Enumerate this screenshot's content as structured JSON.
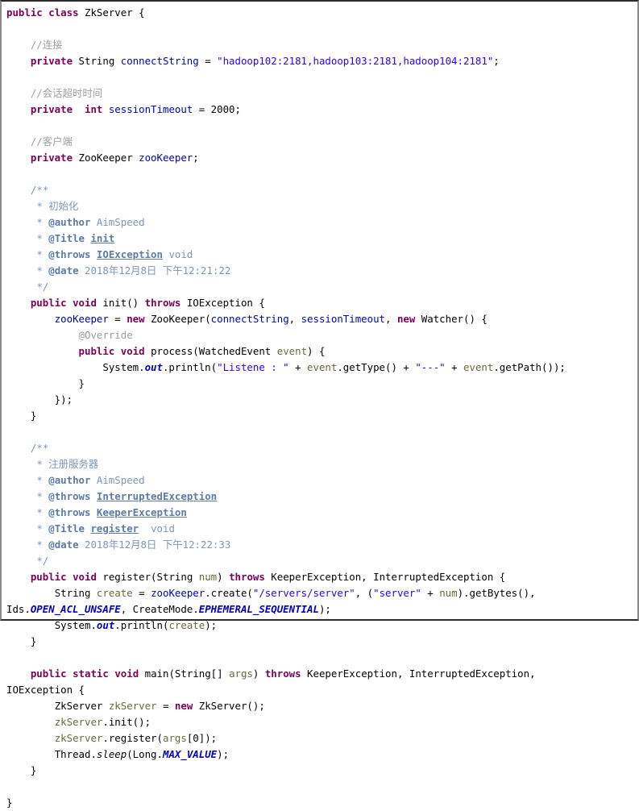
{
  "document": {
    "kind": "java-source-listing",
    "class_name": "ZkServer",
    "background_color": "#ffffff",
    "colors": {
      "keyword": "#7f0055",
      "string": "#2a00ff",
      "comment": "#a0a0a0",
      "javadoc": "#7e96b8",
      "javadoc_tag": "#5c7ba8",
      "field": "#0000c0",
      "local_variable": "#6a6a3c",
      "static_constant": "#0000c0",
      "plain_text": "#000000",
      "border": "#2b2b2b"
    }
  },
  "code": {
    "lines": [
      {
        "id": "l1",
        "tokens": [
          {
            "t": "public",
            "c": "kw"
          },
          {
            "t": " ",
            "c": "plain"
          },
          {
            "t": "class",
            "c": "kw"
          },
          {
            "t": " ZkServer {",
            "c": "plain"
          }
        ]
      },
      {
        "id": "l2",
        "tokens": []
      },
      {
        "id": "l3",
        "tokens": [
          {
            "t": "    ",
            "c": "plain"
          },
          {
            "t": "//连接",
            "c": "cmt"
          }
        ]
      },
      {
        "id": "l4",
        "tokens": [
          {
            "t": "    ",
            "c": "plain"
          },
          {
            "t": "private",
            "c": "kw"
          },
          {
            "t": " String ",
            "c": "plain"
          },
          {
            "t": "connectString",
            "c": "field"
          },
          {
            "t": " = ",
            "c": "plain"
          },
          {
            "t": "\"hadoop102:2181,hadoop103:2181,hadoop104:2181\"",
            "c": "str"
          },
          {
            "t": ";",
            "c": "plain"
          }
        ]
      },
      {
        "id": "l5",
        "tokens": []
      },
      {
        "id": "l6",
        "tokens": [
          {
            "t": "    ",
            "c": "plain"
          },
          {
            "t": "//会话超时时间",
            "c": "cmt"
          }
        ]
      },
      {
        "id": "l7",
        "tokens": [
          {
            "t": "    ",
            "c": "plain"
          },
          {
            "t": "private",
            "c": "kw"
          },
          {
            "t": "  ",
            "c": "plain"
          },
          {
            "t": "int",
            "c": "kw"
          },
          {
            "t": " ",
            "c": "plain"
          },
          {
            "t": "sessionTimeout",
            "c": "field"
          },
          {
            "t": " = 2000;",
            "c": "plain"
          }
        ]
      },
      {
        "id": "l8",
        "tokens": []
      },
      {
        "id": "l9",
        "tokens": [
          {
            "t": "    ",
            "c": "plain"
          },
          {
            "t": "//客户端",
            "c": "cmt"
          }
        ]
      },
      {
        "id": "l10",
        "tokens": [
          {
            "t": "    ",
            "c": "plain"
          },
          {
            "t": "private",
            "c": "kw"
          },
          {
            "t": " ZooKeeper ",
            "c": "plain"
          },
          {
            "t": "zooKeeper",
            "c": "field"
          },
          {
            "t": ";",
            "c": "plain"
          }
        ]
      },
      {
        "id": "l11",
        "tokens": []
      },
      {
        "id": "l12",
        "tokens": [
          {
            "t": "    ",
            "c": "plain"
          },
          {
            "t": "/**",
            "c": "doc"
          }
        ]
      },
      {
        "id": "l13",
        "tokens": [
          {
            "t": "     ",
            "c": "plain"
          },
          {
            "t": "* 初始化",
            "c": "doc"
          }
        ]
      },
      {
        "id": "l14",
        "tokens": [
          {
            "t": "     ",
            "c": "plain"
          },
          {
            "t": "* ",
            "c": "doc"
          },
          {
            "t": "@author",
            "c": "doctag"
          },
          {
            "t": " AimSpeed",
            "c": "doc"
          }
        ]
      },
      {
        "id": "l15",
        "tokens": [
          {
            "t": "     ",
            "c": "plain"
          },
          {
            "t": "* ",
            "c": "doc"
          },
          {
            "t": "@Title",
            "c": "doctag"
          },
          {
            "t": " ",
            "c": "doc"
          },
          {
            "t": "init",
            "c": "docu"
          }
        ]
      },
      {
        "id": "l16",
        "tokens": [
          {
            "t": "     ",
            "c": "plain"
          },
          {
            "t": "* ",
            "c": "doc"
          },
          {
            "t": "@throws",
            "c": "doctag"
          },
          {
            "t": " ",
            "c": "doc"
          },
          {
            "t": "IOException",
            "c": "docu"
          },
          {
            "t": " void",
            "c": "doc"
          }
        ]
      },
      {
        "id": "l17",
        "tokens": [
          {
            "t": "     ",
            "c": "plain"
          },
          {
            "t": "* ",
            "c": "doc"
          },
          {
            "t": "@date",
            "c": "doctag"
          },
          {
            "t": " 2018年12月8日 下午12:21:22",
            "c": "doc"
          }
        ]
      },
      {
        "id": "l18",
        "tokens": [
          {
            "t": "     ",
            "c": "plain"
          },
          {
            "t": "*/",
            "c": "doc"
          }
        ]
      },
      {
        "id": "l19",
        "tokens": [
          {
            "t": "    ",
            "c": "plain"
          },
          {
            "t": "public",
            "c": "kw"
          },
          {
            "t": " ",
            "c": "plain"
          },
          {
            "t": "void",
            "c": "kw"
          },
          {
            "t": " init() ",
            "c": "plain"
          },
          {
            "t": "throws",
            "c": "kw"
          },
          {
            "t": " IOException {",
            "c": "plain"
          }
        ]
      },
      {
        "id": "l20",
        "tokens": [
          {
            "t": "        ",
            "c": "plain"
          },
          {
            "t": "zooKeeper",
            "c": "field"
          },
          {
            "t": " = ",
            "c": "plain"
          },
          {
            "t": "new",
            "c": "kw"
          },
          {
            "t": " ZooKeeper(",
            "c": "plain"
          },
          {
            "t": "connectString",
            "c": "field"
          },
          {
            "t": ", ",
            "c": "plain"
          },
          {
            "t": "sessionTimeout",
            "c": "field"
          },
          {
            "t": ", ",
            "c": "plain"
          },
          {
            "t": "new",
            "c": "kw"
          },
          {
            "t": " Watcher() {",
            "c": "plain"
          }
        ]
      },
      {
        "id": "l21",
        "tokens": [
          {
            "t": "            ",
            "c": "plain"
          },
          {
            "t": "@Override",
            "c": "anno"
          }
        ]
      },
      {
        "id": "l22",
        "tokens": [
          {
            "t": "            ",
            "c": "plain"
          },
          {
            "t": "public",
            "c": "kw"
          },
          {
            "t": " ",
            "c": "plain"
          },
          {
            "t": "void",
            "c": "kw"
          },
          {
            "t": " process(WatchedEvent ",
            "c": "plain"
          },
          {
            "t": "event",
            "c": "local"
          },
          {
            "t": ") {",
            "c": "plain"
          }
        ]
      },
      {
        "id": "l23",
        "tokens": [
          {
            "t": "                ",
            "c": "plain"
          },
          {
            "t": "System.",
            "c": "plain"
          },
          {
            "t": "out",
            "c": "staticf"
          },
          {
            "t": ".println(",
            "c": "plain"
          },
          {
            "t": "\"Listene : \"",
            "c": "str"
          },
          {
            "t": " + ",
            "c": "plain"
          },
          {
            "t": "event",
            "c": "local"
          },
          {
            "t": ".getType() + ",
            "c": "plain"
          },
          {
            "t": "\"---\"",
            "c": "str"
          },
          {
            "t": " + ",
            "c": "plain"
          },
          {
            "t": "event",
            "c": "local"
          },
          {
            "t": ".getPath());",
            "c": "plain"
          }
        ]
      },
      {
        "id": "l24",
        "tokens": [
          {
            "t": "            }",
            "c": "plain"
          }
        ]
      },
      {
        "id": "l25",
        "tokens": [
          {
            "t": "        });",
            "c": "plain"
          }
        ]
      },
      {
        "id": "l26",
        "tokens": [
          {
            "t": "    }",
            "c": "plain"
          }
        ]
      },
      {
        "id": "l27",
        "tokens": []
      },
      {
        "id": "l28",
        "tokens": [
          {
            "t": "    ",
            "c": "plain"
          },
          {
            "t": "/**",
            "c": "doc"
          }
        ]
      },
      {
        "id": "l29",
        "tokens": [
          {
            "t": "     ",
            "c": "plain"
          },
          {
            "t": "* 注册服务器",
            "c": "doc"
          }
        ]
      },
      {
        "id": "l30",
        "tokens": [
          {
            "t": "     ",
            "c": "plain"
          },
          {
            "t": "* ",
            "c": "doc"
          },
          {
            "t": "@author",
            "c": "doctag"
          },
          {
            "t": " AimSpeed",
            "c": "doc"
          }
        ]
      },
      {
        "id": "l31",
        "tokens": [
          {
            "t": "     ",
            "c": "plain"
          },
          {
            "t": "* ",
            "c": "doc"
          },
          {
            "t": "@throws",
            "c": "doctag"
          },
          {
            "t": " ",
            "c": "doc"
          },
          {
            "t": "InterruptedException",
            "c": "docu"
          }
        ]
      },
      {
        "id": "l32",
        "tokens": [
          {
            "t": "     ",
            "c": "plain"
          },
          {
            "t": "* ",
            "c": "doc"
          },
          {
            "t": "@throws",
            "c": "doctag"
          },
          {
            "t": " ",
            "c": "doc"
          },
          {
            "t": "KeeperException",
            "c": "docu"
          }
        ]
      },
      {
        "id": "l33",
        "tokens": [
          {
            "t": "     ",
            "c": "plain"
          },
          {
            "t": "* ",
            "c": "doc"
          },
          {
            "t": "@Title",
            "c": "doctag"
          },
          {
            "t": " ",
            "c": "doc"
          },
          {
            "t": "register",
            "c": "docu"
          },
          {
            "t": "  void",
            "c": "doc"
          }
        ]
      },
      {
        "id": "l34",
        "tokens": [
          {
            "t": "     ",
            "c": "plain"
          },
          {
            "t": "* ",
            "c": "doc"
          },
          {
            "t": "@date",
            "c": "doctag"
          },
          {
            "t": " 2018年12月8日 下午12:22:33",
            "c": "doc"
          }
        ]
      },
      {
        "id": "l35",
        "tokens": [
          {
            "t": "     ",
            "c": "plain"
          },
          {
            "t": "*/",
            "c": "doc"
          }
        ]
      },
      {
        "id": "l36",
        "tokens": [
          {
            "t": "    ",
            "c": "plain"
          },
          {
            "t": "public",
            "c": "kw"
          },
          {
            "t": " ",
            "c": "plain"
          },
          {
            "t": "void",
            "c": "kw"
          },
          {
            "t": " register(String ",
            "c": "plain"
          },
          {
            "t": "num",
            "c": "local"
          },
          {
            "t": ") ",
            "c": "plain"
          },
          {
            "t": "throws",
            "c": "kw"
          },
          {
            "t": " KeeperException, InterruptedException {",
            "c": "plain"
          }
        ]
      },
      {
        "id": "l37",
        "tokens": [
          {
            "t": "        ",
            "c": "plain"
          },
          {
            "t": "String ",
            "c": "plain"
          },
          {
            "t": "create",
            "c": "local"
          },
          {
            "t": " = ",
            "c": "plain"
          },
          {
            "t": "zooKeeper",
            "c": "field"
          },
          {
            "t": ".create(",
            "c": "plain"
          },
          {
            "t": "\"/servers/server\"",
            "c": "str"
          },
          {
            "t": ", (",
            "c": "plain"
          },
          {
            "t": "\"server\"",
            "c": "str"
          },
          {
            "t": " + ",
            "c": "plain"
          },
          {
            "t": "num",
            "c": "local"
          },
          {
            "t": ").getBytes(),",
            "c": "plain"
          }
        ]
      },
      {
        "id": "l38",
        "tokens": [
          {
            "t": "Ids.",
            "c": "plain"
          },
          {
            "t": "OPEN_ACL_UNSAFE",
            "c": "statc"
          },
          {
            "t": ", CreateMode.",
            "c": "plain"
          },
          {
            "t": "EPHEMERAL_SEQUENTIAL",
            "c": "statc"
          },
          {
            "t": ");",
            "c": "plain"
          }
        ]
      },
      {
        "id": "l39",
        "tokens": [
          {
            "t": "        ",
            "c": "plain"
          },
          {
            "t": "System.",
            "c": "plain"
          },
          {
            "t": "out",
            "c": "staticf"
          },
          {
            "t": ".println(",
            "c": "plain"
          },
          {
            "t": "create",
            "c": "local"
          },
          {
            "t": ");",
            "c": "plain"
          }
        ]
      },
      {
        "id": "l40",
        "tokens": [
          {
            "t": "    }",
            "c": "plain"
          }
        ]
      },
      {
        "id": "l41",
        "tokens": []
      },
      {
        "id": "l42",
        "tokens": [
          {
            "t": "    ",
            "c": "plain"
          },
          {
            "t": "public",
            "c": "kw"
          },
          {
            "t": " ",
            "c": "plain"
          },
          {
            "t": "static",
            "c": "kw"
          },
          {
            "t": " ",
            "c": "plain"
          },
          {
            "t": "void",
            "c": "kw"
          },
          {
            "t": " main(String[] ",
            "c": "plain"
          },
          {
            "t": "args",
            "c": "local"
          },
          {
            "t": ") ",
            "c": "plain"
          },
          {
            "t": "throws",
            "c": "kw"
          },
          {
            "t": " KeeperException, InterruptedException,",
            "c": "plain"
          }
        ]
      },
      {
        "id": "l43",
        "tokens": [
          {
            "t": "IOException {",
            "c": "plain"
          }
        ]
      },
      {
        "id": "l44",
        "tokens": [
          {
            "t": "        ",
            "c": "plain"
          },
          {
            "t": "ZkServer ",
            "c": "plain"
          },
          {
            "t": "zkServer",
            "c": "local"
          },
          {
            "t": " = ",
            "c": "plain"
          },
          {
            "t": "new",
            "c": "kw"
          },
          {
            "t": " ZkServer();",
            "c": "plain"
          }
        ]
      },
      {
        "id": "l45",
        "tokens": [
          {
            "t": "        ",
            "c": "plain"
          },
          {
            "t": "zkServer",
            "c": "local"
          },
          {
            "t": ".init();",
            "c": "plain"
          }
        ]
      },
      {
        "id": "l46",
        "tokens": [
          {
            "t": "        ",
            "c": "plain"
          },
          {
            "t": "zkServer",
            "c": "local"
          },
          {
            "t": ".register(",
            "c": "plain"
          },
          {
            "t": "args",
            "c": "local"
          },
          {
            "t": "[0]);",
            "c": "plain"
          }
        ]
      },
      {
        "id": "l47",
        "tokens": [
          {
            "t": "        ",
            "c": "plain"
          },
          {
            "t": "Thread.",
            "c": "plain"
          },
          {
            "t": "sleep",
            "c": "staticm"
          },
          {
            "t": "(Long.",
            "c": "plain"
          },
          {
            "t": "MAX_VALUE",
            "c": "statc"
          },
          {
            "t": ");",
            "c": "plain"
          }
        ]
      },
      {
        "id": "l48",
        "tokens": [
          {
            "t": "    }",
            "c": "plain"
          }
        ]
      },
      {
        "id": "l49",
        "tokens": []
      },
      {
        "id": "l50",
        "tokens": [
          {
            "t": "}",
            "c": "plain"
          }
        ]
      }
    ]
  }
}
